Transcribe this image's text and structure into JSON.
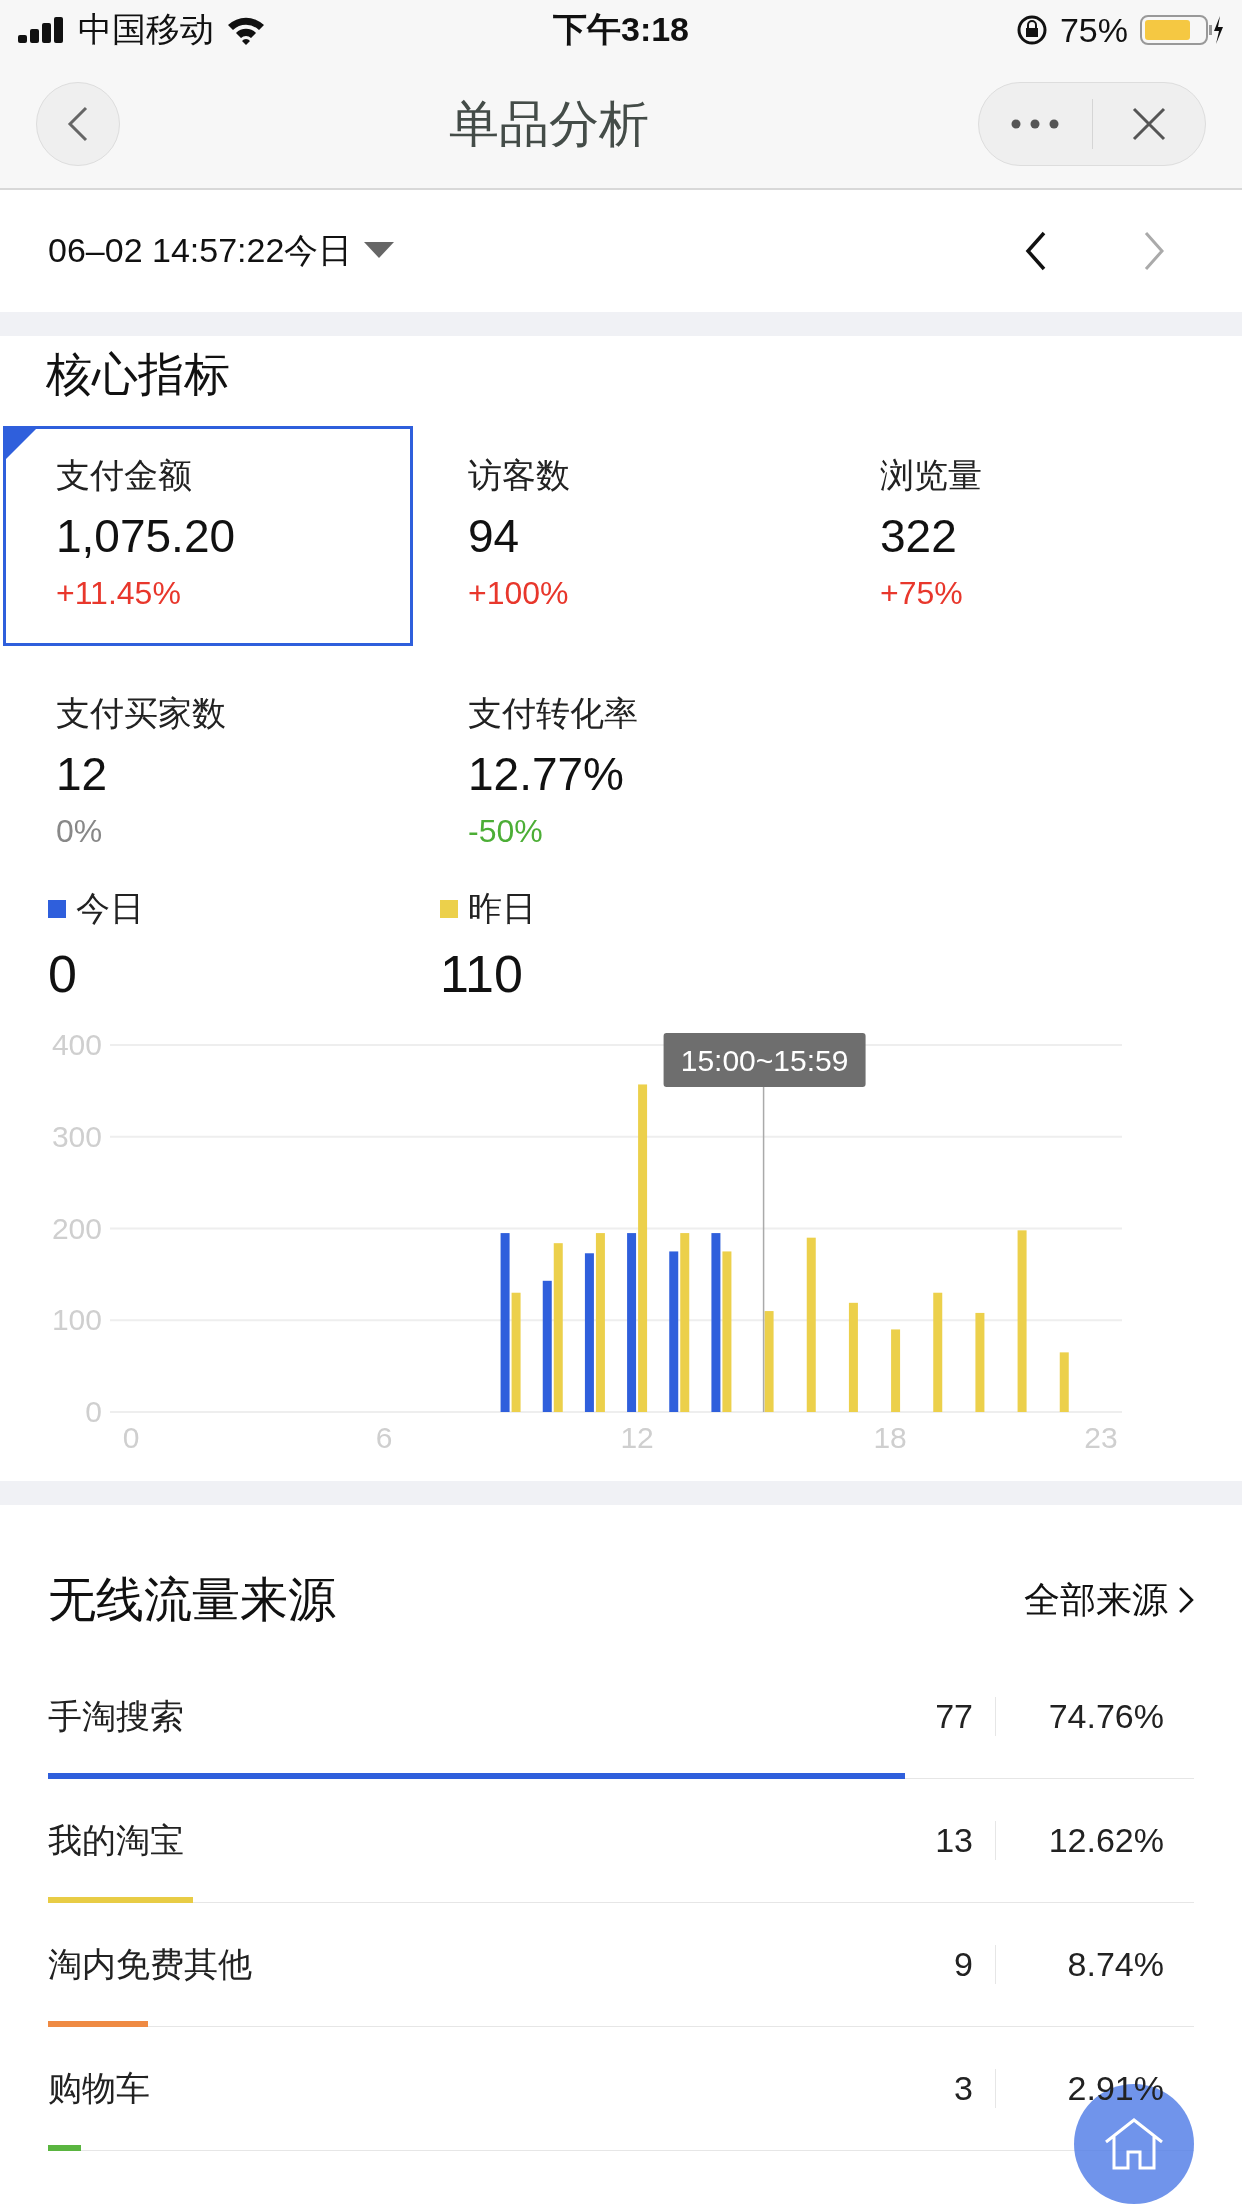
{
  "status_bar": {
    "carrier": "中国移动",
    "time": "下午3:18",
    "battery": "75%"
  },
  "nav": {
    "title": "单品分析"
  },
  "date_bar": {
    "date": "06–02 14:57:22今日"
  },
  "core": {
    "title": "核心指标",
    "metrics": [
      {
        "label": "支付金额",
        "value": "1,075.20",
        "change": "+11.45%",
        "color": "#e8372c",
        "selected": true
      },
      {
        "label": "访客数",
        "value": "94",
        "change": "+100%",
        "color": "#e8372c",
        "selected": false
      },
      {
        "label": "浏览量",
        "value": "322",
        "change": "+75%",
        "color": "#e8372c",
        "selected": false
      },
      {
        "label": "支付买家数",
        "value": "12",
        "change": "0%",
        "color": "#888888",
        "selected": false
      },
      {
        "label": "支付转化率",
        "value": "12.77%",
        "change": "-50%",
        "color": "#4cae36",
        "selected": false
      }
    ]
  },
  "legend_readings": [
    "0",
    "110"
  ],
  "chart_data": {
    "type": "bar",
    "x": [
      0,
      1,
      2,
      3,
      4,
      5,
      6,
      7,
      8,
      9,
      10,
      11,
      12,
      13,
      14,
      15,
      16,
      17,
      18,
      19,
      20,
      21,
      22,
      23
    ],
    "series": [
      {
        "name": "今日",
        "color": "#2f5fdc",
        "values": [
          0,
          0,
          0,
          0,
          0,
          0,
          0,
          0,
          0,
          195,
          143,
          173,
          195,
          175,
          195,
          null,
          null,
          null,
          null,
          null,
          null,
          null,
          null,
          null
        ]
      },
      {
        "name": "昨日",
        "color": "#ecd04b",
        "values": [
          0,
          0,
          0,
          0,
          0,
          0,
          0,
          0,
          0,
          130,
          184,
          195,
          357,
          195,
          175,
          110,
          190,
          119,
          90,
          130,
          108,
          198,
          65,
          0
        ]
      }
    ],
    "xlim": [
      -0.5,
      23.5
    ],
    "ylim": [
      0,
      400
    ],
    "yticks": [
      0,
      100,
      200,
      300,
      400
    ],
    "xticks": [
      0,
      6,
      12,
      18,
      23
    ],
    "grid": true,
    "ref_lines": [
      {
        "axis": "x",
        "value": 15
      }
    ],
    "annotations": [
      "15:00~15:59"
    ]
  },
  "traffic": {
    "title": "无线流量来源",
    "link": "全部来源",
    "rows": [
      {
        "name": "手淘搜索",
        "count": "77",
        "share": "74.76%",
        "color": "#2f5fdc",
        "level": 0.7476
      },
      {
        "name": "我的淘宝",
        "count": "13",
        "share": "12.62%",
        "color": "#e8cc45",
        "level": 0.1262
      },
      {
        "name": "淘内免费其他",
        "count": "9",
        "share": "8.74%",
        "color": "#ef8a43",
        "level": 0.0874
      },
      {
        "name": "购物车",
        "count": "3",
        "share": "2.91%",
        "color": "#5ab540",
        "level": 0.0291
      }
    ]
  }
}
